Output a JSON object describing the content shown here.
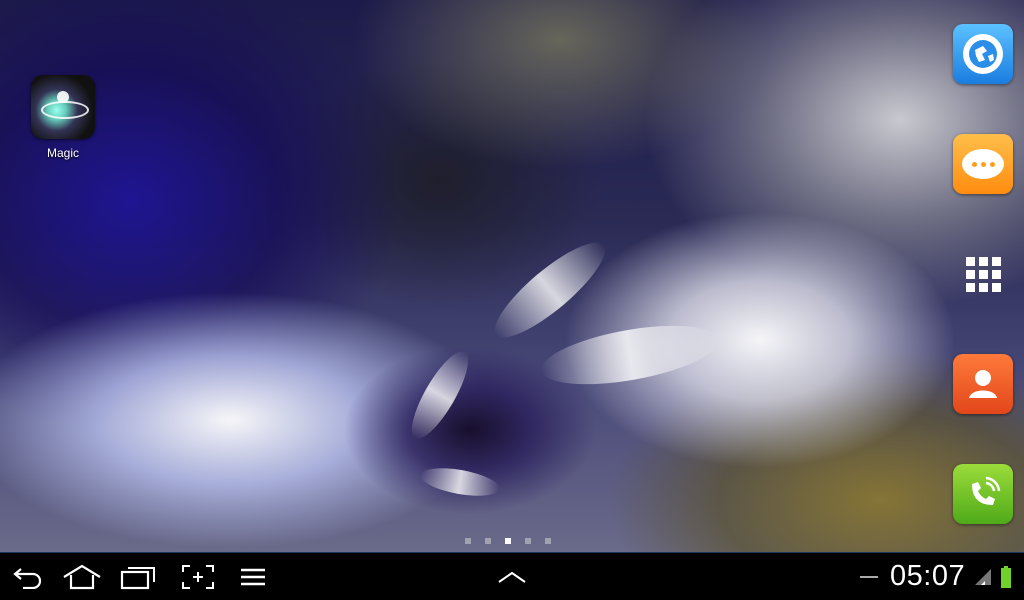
{
  "desktop": {
    "shortcuts": [
      {
        "label": "Magic",
        "icon": "magic-app-icon"
      }
    ],
    "page_indicator": {
      "count": 5,
      "active_index": 2
    }
  },
  "dock": {
    "items": [
      {
        "name": "browser",
        "icon": "globe-icon",
        "color": "#1a7de0"
      },
      {
        "name": "messages",
        "icon": "chat-bubble-icon",
        "color": "#ff8c0f"
      },
      {
        "name": "apps",
        "icon": "app-grid-icon",
        "color": "#ffffff"
      },
      {
        "name": "contacts",
        "icon": "contact-icon",
        "color": "#e2461a"
      },
      {
        "name": "phone",
        "icon": "phone-icon",
        "color": "#4faa19"
      }
    ]
  },
  "system_bar": {
    "nav_icons": [
      "back-icon",
      "home-icon",
      "recent-apps-icon",
      "screenshot-icon",
      "menu-icon"
    ],
    "center_icon": "chevron-up-icon",
    "clock": "05:07",
    "battery_color": "#6fd12a"
  }
}
